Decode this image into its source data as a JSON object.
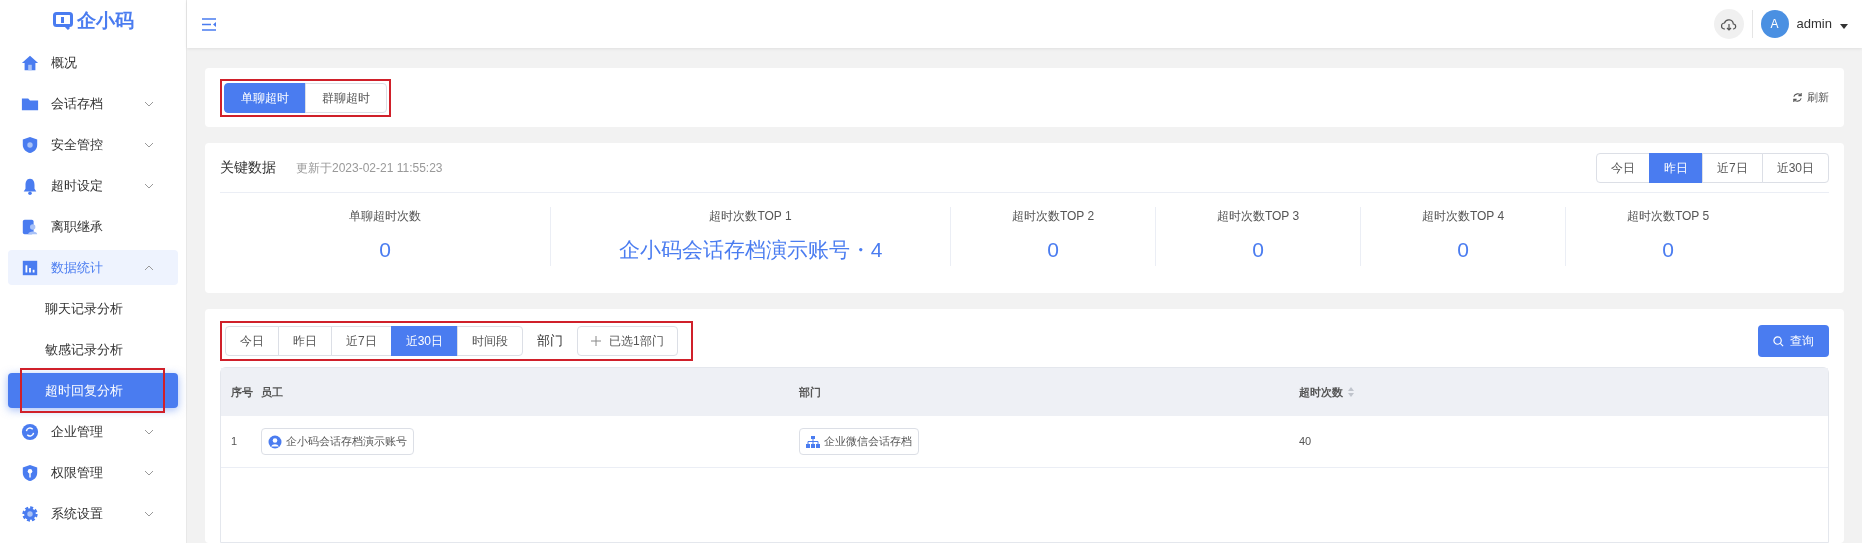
{
  "logo": {
    "text": "企小码"
  },
  "sidebar": {
    "items": [
      {
        "label": "概况",
        "selected": false
      },
      {
        "label": "会话存档",
        "selected": false,
        "expanded": false
      },
      {
        "label": "安全管控",
        "selected": false,
        "expanded": false
      },
      {
        "label": "超时设定",
        "selected": false,
        "expanded": false
      },
      {
        "label": "离职继承",
        "selected": false
      },
      {
        "label": "数据统计",
        "selected": true,
        "expanded": true,
        "children": [
          {
            "label": "聊天记录分析",
            "selected": false
          },
          {
            "label": "敏感记录分析",
            "selected": false
          },
          {
            "label": "超时回复分析",
            "selected": true,
            "highlighted": true
          }
        ]
      },
      {
        "label": "企业管理",
        "selected": false,
        "expanded": false
      },
      {
        "label": "权限管理",
        "selected": false,
        "expanded": false
      },
      {
        "label": "系统设置",
        "selected": false,
        "expanded": false
      }
    ]
  },
  "header": {
    "avatar": "A",
    "user": "admin"
  },
  "mode_tabs": {
    "highlighted": true,
    "tabs": [
      {
        "label": "单聊超时",
        "selected": true
      },
      {
        "label": "群聊超时",
        "selected": false
      }
    ]
  },
  "refresh": {
    "label": "刷新"
  },
  "key_data": {
    "title": "关键数据",
    "updated": "更新于2023-02-21 11:55:23",
    "range_tabs": [
      {
        "label": "今日",
        "selected": false
      },
      {
        "label": "昨日",
        "selected": true
      },
      {
        "label": "近7日",
        "selected": false
      },
      {
        "label": "近30日",
        "selected": false
      }
    ],
    "stats": [
      {
        "label": "单聊超时次数",
        "value": "0"
      },
      {
        "label": "超时次数TOP 1",
        "value": "企小码会话存档演示账号・4"
      },
      {
        "label": "超时次数TOP 2",
        "value": "0"
      },
      {
        "label": "超时次数TOP 3",
        "value": "0"
      },
      {
        "label": "超时次数TOP 4",
        "value": "0"
      },
      {
        "label": "超时次数TOP 5",
        "value": "0"
      }
    ]
  },
  "filters": {
    "highlighted": true,
    "range_tabs": [
      {
        "label": "今日",
        "selected": false
      },
      {
        "label": "昨日",
        "selected": false
      },
      {
        "label": "近7日",
        "selected": false
      },
      {
        "label": "近30日",
        "selected": true
      },
      {
        "label": "时间段",
        "selected": false
      }
    ],
    "department_label": "部门",
    "department_button": "已选1部门",
    "query_button": "查询"
  },
  "table": {
    "columns": [
      {
        "label": "序号",
        "sortable": false
      },
      {
        "label": "员工",
        "sortable": false
      },
      {
        "label": "部门",
        "sortable": false
      },
      {
        "label": "超时次数",
        "sortable": true
      }
    ],
    "rows": [
      {
        "index": "1",
        "employee": "企小码会话存档演示账号",
        "department": "企业微信会话存档",
        "count": "40"
      }
    ]
  }
}
